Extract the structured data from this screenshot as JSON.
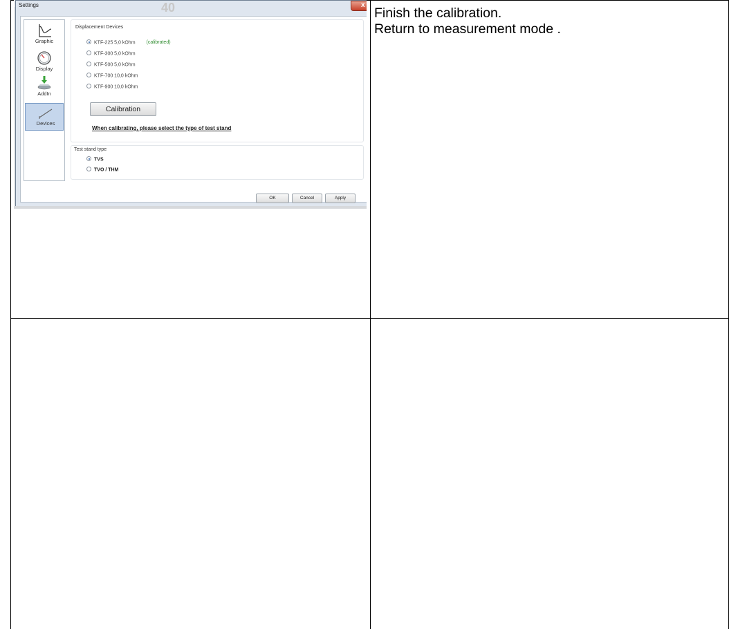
{
  "right_cell": {
    "line1": "Finish the calibration.",
    "line2": "Return to measurement mode ."
  },
  "dialog": {
    "title": "Settings",
    "background_ghost_text": "40",
    "close_label": "x",
    "sidebar": {
      "items": [
        {
          "label": "Graphic",
          "icon": "graph-curve-icon"
        },
        {
          "label": "Display",
          "icon": "gauge-icon"
        },
        {
          "label": "AddIn",
          "icon": "addin-download-icon"
        },
        {
          "label": "Devices",
          "icon": "sensor-rod-icon",
          "active": true
        }
      ]
    },
    "displacement_group": {
      "title": "Displacement Devices",
      "devices": [
        {
          "label": "KTF-225  5,0 kOhm",
          "selected": true,
          "status": "(calibrated)"
        },
        {
          "label": "KTF-300  5,0 kOhm",
          "selected": false
        },
        {
          "label": "KTF-500  5,0 kOhm",
          "selected": false
        },
        {
          "label": "KTF-700  10,0 kOhm",
          "selected": false
        },
        {
          "label": "KTF-900  10,0 kOhm",
          "selected": false
        }
      ],
      "calibration_button": "Calibration",
      "note": "When calibrating, please select the type of test stand"
    },
    "test_stand_group": {
      "title": "Test stand type",
      "options": [
        {
          "label": "TVS",
          "selected": true
        },
        {
          "label": "TVO / THM",
          "selected": false
        }
      ]
    },
    "buttons": {
      "ok": "OK",
      "cancel": "Cancel",
      "apply": "Apply"
    }
  },
  "colors": {
    "calibrated_status": "#2e8b2e",
    "active_tab": "#c5d6ec",
    "close_button": "#c7402a"
  }
}
